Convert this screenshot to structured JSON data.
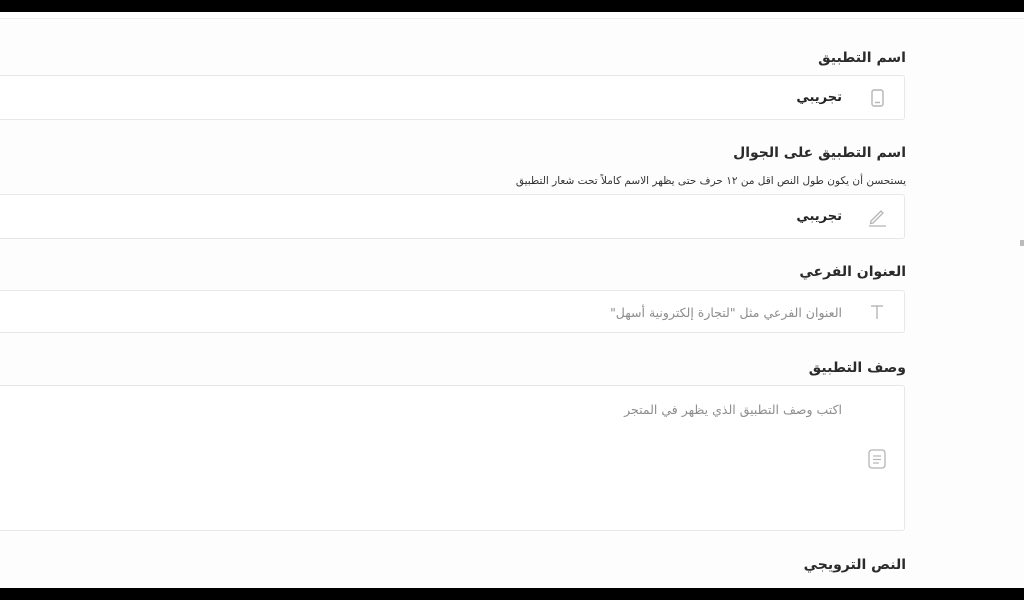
{
  "form": {
    "app_name": {
      "label": "اسم التطبيق",
      "value": "تجريبي",
      "icon": "phone-icon"
    },
    "mobile_name": {
      "label": "اسم التطبيق على الجوال",
      "hint": "يستحسن أن يكون طول النص اقل من ١٢ حرف حتى يظهر الاسم كاملاً تحت شعار التطبيق",
      "value": "تجريبي",
      "icon": "pencil-icon"
    },
    "subtitle": {
      "label": "العنوان الفرعي",
      "placeholder": "العنوان الفرعي مثل \"لتجارة إلكترونية أسهل\"",
      "icon": "text-t-icon"
    },
    "description": {
      "label": "وصف التطبيق",
      "placeholder": "اكتب وصف التطبيق الذي يظهر في المتجر",
      "icon": "document-icon"
    },
    "promo_text": {
      "label": "النص الترويجي"
    }
  },
  "colors": {
    "background": "#fdfdfd",
    "field_border": "#e7e7e7",
    "label_text": "#2b2b2b",
    "placeholder_text": "#8d8d8d",
    "icon_stroke": "#b5b5b5",
    "letterbox": "#000000"
  }
}
